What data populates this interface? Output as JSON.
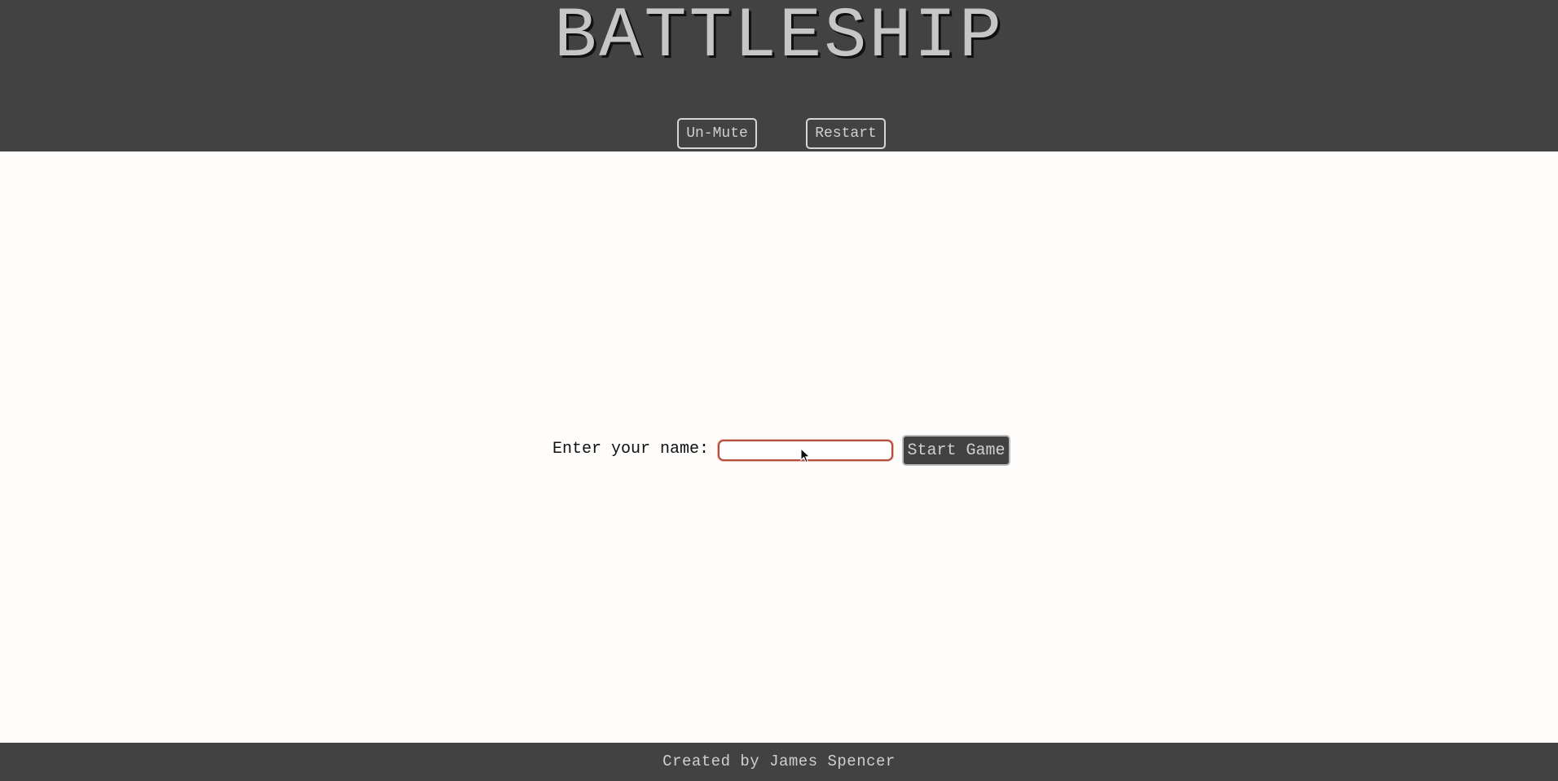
{
  "header": {
    "title": "BATTLESHIP",
    "mute_label": "Un-Mute",
    "restart_label": "Restart"
  },
  "main": {
    "name_label": "Enter your name:",
    "name_value": "",
    "start_label": "Start Game"
  },
  "footer": {
    "credit": "Created by James Spencer"
  },
  "icons": {
    "cursor": "mouse-pointer-icon"
  },
  "colors": {
    "header_bg": "#424242",
    "page_bg": "#fefdfb",
    "title_text": "#c6c6c6",
    "input_focus_border": "#b5503d",
    "button_text": "#cfcfcf"
  }
}
